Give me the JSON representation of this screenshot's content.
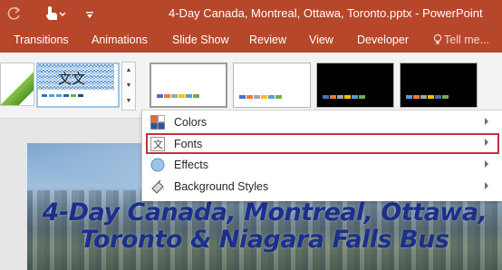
{
  "app": {
    "window_title": "4-Day Canada, Montreal, Ottawa, Toronto.pptx - PowerPoint",
    "accent_color": "#b7472a"
  },
  "qat": {
    "undo_icon": "redo-arrow-icon",
    "touch_icon": "touch-mouse-mode-icon",
    "customize_icon": "customize-qat-icon"
  },
  "ribbon_tabs": [
    {
      "label": "Transitions"
    },
    {
      "label": "Animations"
    },
    {
      "label": "Slide Show"
    },
    {
      "label": "Review"
    },
    {
      "label": "View"
    },
    {
      "label": "Developer"
    }
  ],
  "tell_me": {
    "label": "Tell me...",
    "icon": "lightbulb-icon"
  },
  "variants_menu": {
    "items": [
      {
        "label": "Colors",
        "icon": "colors-icon",
        "highlighted": false
      },
      {
        "label": "Fonts",
        "icon": "fonts-icon",
        "highlighted": true
      },
      {
        "label": "Effects",
        "icon": "effects-icon",
        "highlighted": false
      },
      {
        "label": "Background Styles",
        "icon": "background-styles-icon",
        "highlighted": false
      }
    ]
  },
  "slide": {
    "title_lines": [
      "4-Day Canada, Montreal, Ottawa,",
      "Toronto & Niagara Falls Bus"
    ],
    "title_color": "#1b2f8c"
  }
}
